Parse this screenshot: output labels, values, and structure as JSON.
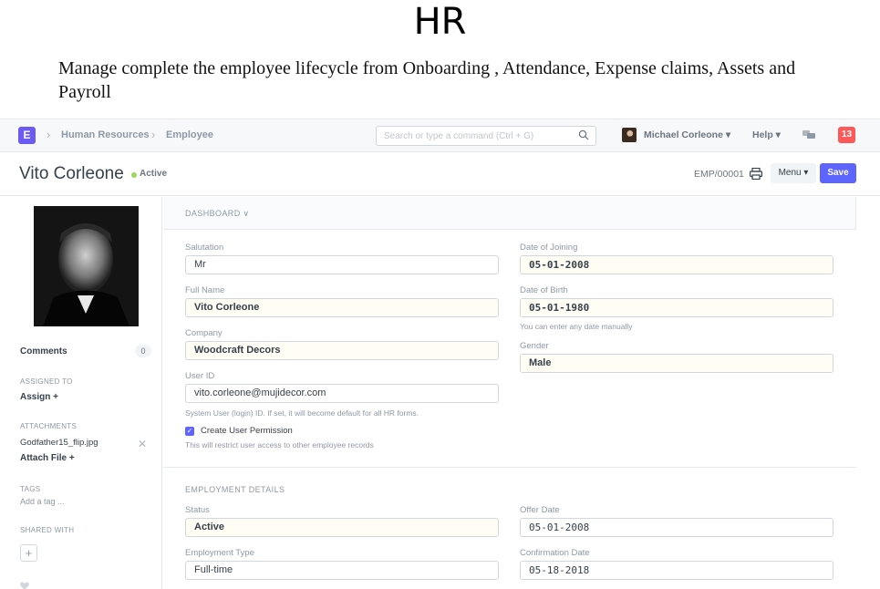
{
  "slide": {
    "title": "HR",
    "description": "Manage complete the employee lifecycle from Onboarding , Attendance, Expense claims, Assets and Payroll"
  },
  "navbar": {
    "logo_letter": "E",
    "breadcrumbs": [
      "Human Resources",
      "Employee"
    ],
    "search_placeholder": "Search or type a command (Ctrl + G)",
    "user_menu": "Michael Corleone ▾",
    "help_menu": "Help ▾",
    "notification_count": "13"
  },
  "page_head": {
    "title": "Vito Corleone",
    "status": "Active",
    "record_id": "EMP/00001",
    "menu_label": "Menu ▾",
    "save_label": "Save"
  },
  "sidebar": {
    "comments_label": "Comments",
    "comments_count": "0",
    "assigned_to_label": "ASSIGNED TO",
    "assign_action": "Assign +",
    "attachments_label": "ATTACHMENTS",
    "attachment_file": "Godfather15_flip.jpg",
    "attach_action": "Attach File +",
    "tags_label": "TAGS",
    "add_tag": "Add a tag ...",
    "shared_with_label": "SHARED WITH",
    "share_add": "+"
  },
  "form": {
    "dashboard_label": "DASHBOARD ∨",
    "salutation_label": "Salutation",
    "salutation_value": "Mr",
    "full_name_label": "Full Name",
    "full_name_value": "Vito Corleone",
    "company_label": "Company",
    "company_value": "Woodcraft Decors",
    "user_id_label": "User ID",
    "user_id_value": "vito.corleone@mujidecor.com",
    "user_id_help": "System User (login) ID. If set, it will become default for all HR forms.",
    "create_permission_label": "Create User Permission",
    "create_permission_help": "This will restrict user access to other employee records",
    "date_of_joining_label": "Date of Joining",
    "date_of_joining_value": "05-01-2008",
    "date_of_birth_label": "Date of Birth",
    "date_of_birth_value": "05-01-1980",
    "date_help": "You can enter any date manually",
    "gender_label": "Gender",
    "gender_value": "Male",
    "employment_section": "EMPLOYMENT DETAILS",
    "status_label": "Status",
    "status_value": "Active",
    "employment_type_label": "Employment Type",
    "employment_type_value": "Full-time",
    "offer_date_label": "Offer Date",
    "offer_date_value": "05-01-2008",
    "confirmation_date_label": "Confirmation Date",
    "confirmation_date_value": "05-18-2018"
  }
}
